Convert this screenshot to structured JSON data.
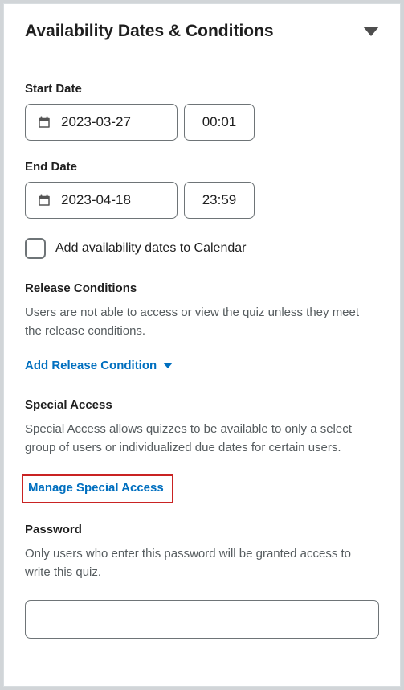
{
  "panel": {
    "title": "Availability Dates & Conditions"
  },
  "startDate": {
    "label": "Start Date",
    "date": "2023-03-27",
    "time": "00:01"
  },
  "endDate": {
    "label": "End Date",
    "date": "2023-04-18",
    "time": "23:59"
  },
  "calendarCheckbox": {
    "label": "Add availability dates to Calendar"
  },
  "releaseConditions": {
    "heading": "Release Conditions",
    "help": "Users are not able to access or view the quiz unless they meet the release conditions.",
    "addLabel": "Add Release Condition"
  },
  "specialAccess": {
    "heading": "Special Access",
    "help": "Special Access allows quizzes to be available to only a select group of users or individualized due dates for certain users.",
    "manageLabel": "Manage Special Access"
  },
  "password": {
    "heading": "Password",
    "help": "Only users who enter this password will be granted access to write this quiz.",
    "value": ""
  }
}
